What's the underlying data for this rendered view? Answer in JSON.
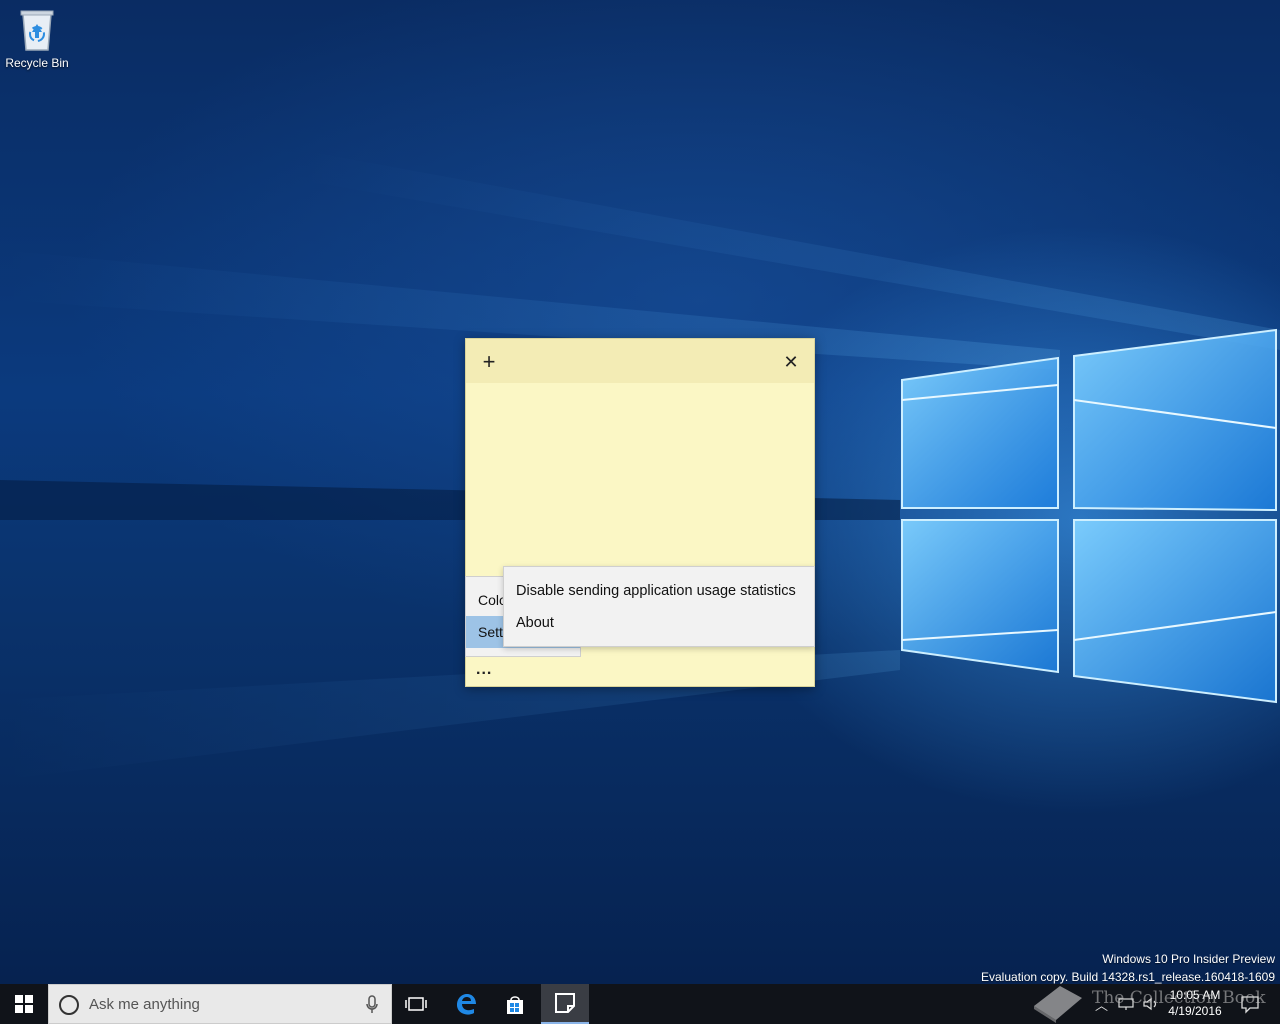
{
  "desktop": {
    "icons": [
      {
        "label": "Recycle Bin",
        "icon": "recycle-bin-icon"
      }
    ]
  },
  "sticky_note": {
    "add_icon": "+",
    "close_icon": "✕",
    "more_label": "...",
    "background_color": "#fbf7c5",
    "header_color": "#f3ecb5"
  },
  "menu": {
    "items": [
      {
        "label": "Colo"
      },
      {
        "label": "Sett",
        "highlighted": true
      }
    ],
    "submenu": {
      "items": [
        {
          "label": "Disable sending application usage statistics"
        },
        {
          "label": "About"
        }
      ]
    },
    "highlight_color": "#9dc3e6"
  },
  "watermark": {
    "line1": "Windows 10 Pro Insider Preview",
    "line2": "Evaluation copy. Build 14328.rs1_release.160418-1609"
  },
  "taskbar": {
    "search_placeholder": "Ask me anything",
    "apps": [
      "task-view-icon",
      "edge-icon",
      "store-icon",
      "sticky-notes-icon"
    ],
    "clock": {
      "time": "10:05 AM",
      "date": "4/19/2016"
    },
    "brand_text": "The Collection Book"
  }
}
